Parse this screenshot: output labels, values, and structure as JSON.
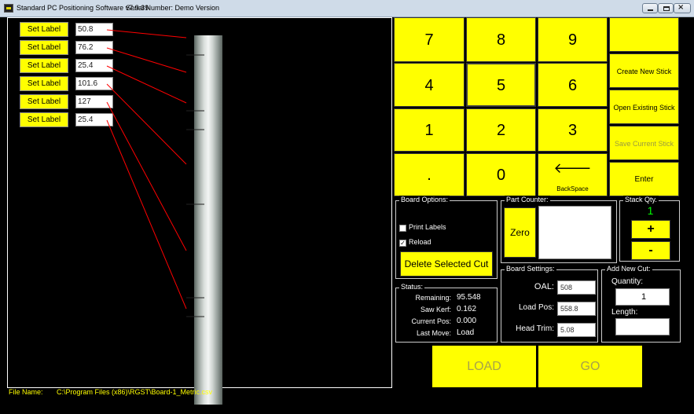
{
  "window": {
    "title": "Standard PC Positioning Software v7.9.39",
    "serial": "Serial Number: Demo Version"
  },
  "cuts": [
    {
      "button": "Set Label",
      "length": "50.8"
    },
    {
      "button": "Set Label",
      "length": "76.2"
    },
    {
      "button": "Set Label",
      "length": "25.4"
    },
    {
      "button": "Set Label",
      "length": "101.6"
    },
    {
      "button": "Set Label",
      "length": "127"
    },
    {
      "button": "Set Label",
      "length": "25.4"
    }
  ],
  "file": {
    "label": "File Name:",
    "path": "C:\\Program Files (x86)\\RGST\\Board-1_Metric.csv"
  },
  "keypad": {
    "k7": "7",
    "k8": "8",
    "k9": "9",
    "k4": "4",
    "k5": "5",
    "k6": "6",
    "k1": "1",
    "k2": "2",
    "k3": "3",
    "dot": ".",
    "k0": "0",
    "backspace_arrow": "🡐",
    "backspace": "BackSpace",
    "blank": "",
    "create": "Create New Stick",
    "open": "Open Existing Stick",
    "save": "Save Current Stick",
    "enter": "Enter"
  },
  "board_options": {
    "legend": "Board Options:",
    "print_labels": "Print Labels",
    "print_labels_checked": false,
    "reload": "Reload",
    "reload_checked": true,
    "delete_btn": "Delete Selected Cut"
  },
  "part_counter": {
    "legend": "Part Counter:",
    "zero_btn": "Zero",
    "value": ""
  },
  "stack_qty": {
    "legend": "Stack Qty.",
    "value": "1",
    "plus": "+",
    "minus": "-",
    "value_color": "#00ff00"
  },
  "status": {
    "legend": "Status:",
    "remaining_label": "Remaining:",
    "remaining": "95.548",
    "kerf_label": "Saw Kerf:",
    "kerf": "0.162",
    "pos_label": "Current Pos:",
    "pos": "0.000",
    "last_move_label": "Last Move:",
    "last_move": "Load"
  },
  "board_settings": {
    "legend": "Board Settings:",
    "oal_label": "OAL:",
    "oal": "508",
    "load_pos_label": "Load Pos:",
    "load_pos": "558.8",
    "head_trim_label": "Head Trim:",
    "head_trim": "5.08"
  },
  "add_new_cut": {
    "legend": "Add New Cut:",
    "quantity_label": "Quantity:",
    "quantity": "1",
    "length_label": "Length:",
    "length": ""
  },
  "actions": {
    "load": "LOAD",
    "go": "GO"
  },
  "colors": {
    "accent": "#ffff00",
    "background": "#000000",
    "cut_line": "#ff0000"
  }
}
